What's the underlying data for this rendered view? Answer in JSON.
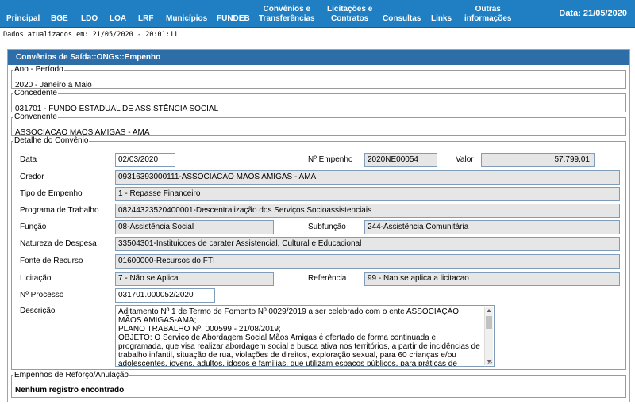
{
  "nav": {
    "items": [
      {
        "label": "Principal"
      },
      {
        "label": "BGE"
      },
      {
        "label": "LDO"
      },
      {
        "label": "LOA"
      },
      {
        "label": "LRF"
      },
      {
        "label": "Municípios"
      },
      {
        "label": "FUNDEB"
      },
      {
        "label": "Convênios e\nTransferências"
      },
      {
        "label": "Licitações e\nContratos"
      },
      {
        "label": "Consultas"
      },
      {
        "label": "Links"
      },
      {
        "label": "Outras\ninformações"
      }
    ],
    "date": "Data: 21/05/2020"
  },
  "updated_text": "Dados atualizados em: 21/05/2020 - 20:01:11",
  "panel": {
    "title": "Convênios de Saída::ONGs::Empenho",
    "ano_periodo": {
      "legend": "Ano - Período",
      "value": "2020 - Janeiro a Maio"
    },
    "concedente": {
      "legend": "Concedente",
      "value": "031701 - FUNDO ESTADUAL DE ASSISTÊNCIA SOCIAL"
    },
    "convenente": {
      "legend": "Convenente",
      "value": "ASSOCIACAO MAOS AMIGAS - AMA"
    },
    "detalhe": {
      "legend": "Detalhe do Convênio",
      "data_label": "Data",
      "data_value": "02/03/2020",
      "empenho_label": "Nº Empenho",
      "empenho_value": "2020NE00054",
      "valor_label": "Valor",
      "valor_value": "57.799,01",
      "credor_label": "Credor",
      "credor_value": "09316393000111-ASSOCIACAO MAOS AMIGAS - AMA",
      "tipo_label": "Tipo de Empenho",
      "tipo_value": "1 - Repasse Financeiro",
      "programa_label": "Programa de Trabalho",
      "programa_value": "08244323520400001-Descentralização dos Serviços Socioassistenciais",
      "funcao_label": "Função",
      "funcao_value": "08-Assistência Social",
      "subfuncao_label": "Subfunção",
      "subfuncao_value": "244-Assistência Comunitária",
      "natureza_label": "Natureza de Despesa",
      "natureza_value": "33504301-Instituicoes de carater Assistencial, Cultural e Educacional",
      "fonte_label": "Fonte de Recurso",
      "fonte_value": "01600000-Recursos do FTI",
      "licitacao_label": "Licitação",
      "licitacao_value": "7 - Não se Aplica",
      "referencia_label": "Referência",
      "referencia_value": "99 - Nao se aplica a licitacao",
      "processo_label": "Nº Processo",
      "processo_value": "031701.000052/2020",
      "descricao_label": "Descrição",
      "descricao_lines": [
        "Aditamento Nº 1 de Termo de Fomento Nº 0029/2019 a ser celebrado com o ente ASSOCIAÇÃO MÃOS AMIGAS-AMA;",
        "PLANO TRABALHO Nº: 000599 - 21/08/2019;",
        "OBJETO: O Serviço de Abordagem Social Mãos Amigas é ofertado de forma continuada e programada, que visa realizar abordagem social e busca ativa nos territórios, a partir de incidências de trabalho infantil, situação de rua, violações de direitos, exploração sexual, para 60 crianças e/ou adolescentes, jovens, adultos, idosos e famílias, que utilizam espaços públicos, para práticas de atividades laborais"
      ]
    },
    "reforco": {
      "legend": "Empenhos de Reforço/Anulação",
      "value": "Nenhum registro encontrado"
    }
  }
}
